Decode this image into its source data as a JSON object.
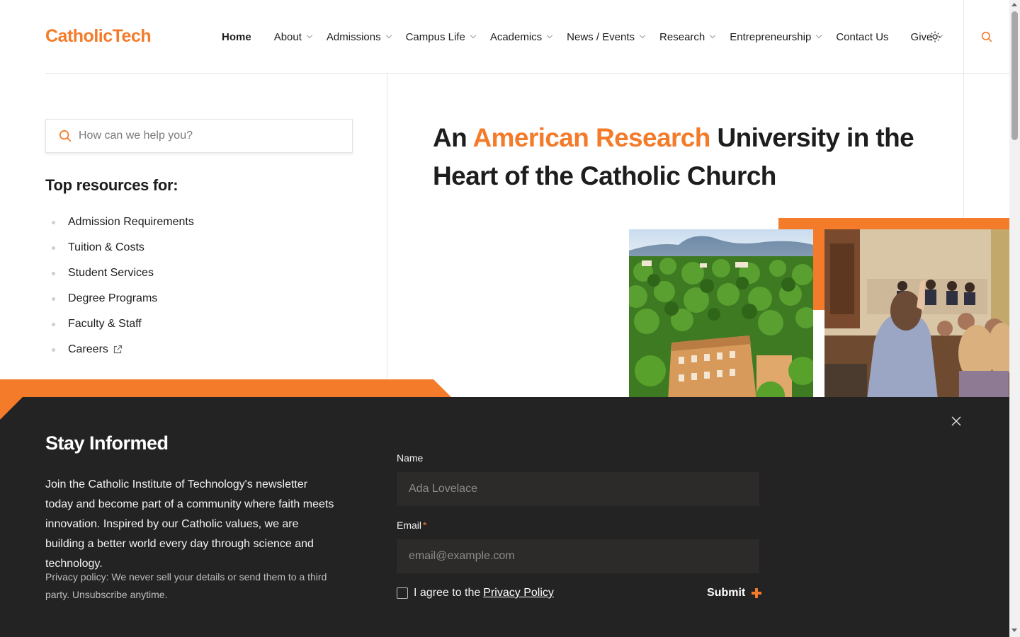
{
  "brand": {
    "logo": "CatholicTech",
    "accent": "#f47b2a"
  },
  "nav": {
    "items": [
      {
        "label": "Home",
        "active": true,
        "dropdown": false
      },
      {
        "label": "About",
        "dropdown": true
      },
      {
        "label": "Admissions",
        "dropdown": true
      },
      {
        "label": "Campus Life",
        "dropdown": true
      },
      {
        "label": "Academics",
        "dropdown": true
      },
      {
        "label": "News / Events",
        "dropdown": true
      },
      {
        "label": "Research",
        "dropdown": true
      },
      {
        "label": "Entrepreneurship",
        "dropdown": true
      },
      {
        "label": "Contact Us",
        "dropdown": false
      },
      {
        "label": "Give",
        "dropdown": true
      }
    ],
    "icons": [
      "sun-icon",
      "search-icon"
    ]
  },
  "sidebar": {
    "search_placeholder": "How can we help you?",
    "resources_title": "Top resources for:",
    "resources": [
      "Admission Requirements",
      "Tuition & Costs",
      "Student Services",
      "Degree Programs",
      "Faculty & Staff",
      "Careers"
    ]
  },
  "hero": {
    "title_prefix": "An ",
    "title_accent": "American Research",
    "title_suffix": " University in the Heart of the Catholic Church"
  },
  "newsletter": {
    "title": "Stay Informed",
    "description": "Join the Catholic Institute of Technology's newsletter today and become part of a community where faith meets innovation. Inspired by our Catholic values, we are building a better world every day through science and technology.",
    "privacy": "Privacy policy: We never sell your details or send them to a third party. Unsubscribe anytime.",
    "name_label": "Name",
    "name_placeholder": "Ada Lovelace",
    "email_label": "Email",
    "email_required_mark": "*",
    "email_placeholder": "email@example.com",
    "agree_text": "I agree to the",
    "agree_link": "Privacy Policy",
    "submit_label": "Submit"
  }
}
